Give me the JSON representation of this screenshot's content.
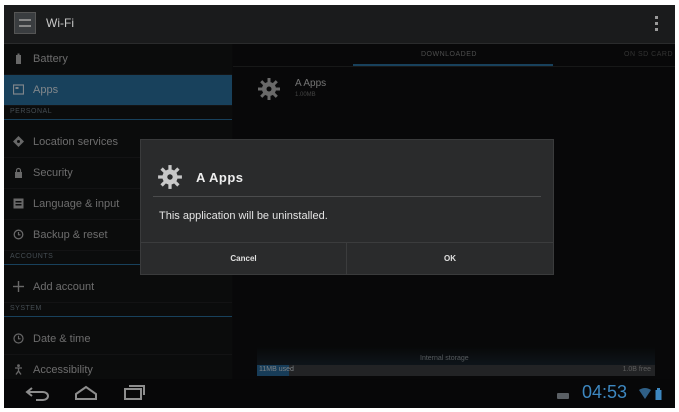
{
  "action_bar": {
    "title": "Wi-Fi"
  },
  "sidebar": {
    "items": [
      {
        "type": "row",
        "label": "Battery",
        "icon": "battery-icon"
      },
      {
        "type": "row",
        "label": "Apps",
        "icon": "apps-icon",
        "selected": true
      },
      {
        "type": "header",
        "label": "PERSONAL"
      },
      {
        "type": "row",
        "label": "Location services",
        "icon": "location-icon"
      },
      {
        "type": "row",
        "label": "Security",
        "icon": "lock-icon"
      },
      {
        "type": "row",
        "label": "Language & input",
        "icon": "keyboard-icon"
      },
      {
        "type": "row",
        "label": "Backup & reset",
        "icon": "backup-icon"
      },
      {
        "type": "header",
        "label": "ACCOUNTS"
      },
      {
        "type": "row",
        "label": "Add account",
        "icon": "plus-icon"
      },
      {
        "type": "header",
        "label": "SYSTEM"
      },
      {
        "type": "row",
        "label": "Date & time",
        "icon": "clock-icon"
      },
      {
        "type": "row",
        "label": "Accessibility",
        "icon": "accessibility-icon"
      }
    ]
  },
  "apps_pane": {
    "tabs": {
      "downloaded": "DOWNLOADED",
      "on_sd_card": "ON SD CARD"
    },
    "app": {
      "name": "A Apps",
      "size": "1.00MB"
    },
    "storage": {
      "title": "Internal storage",
      "used_label": "11MB used",
      "free_label": "1.0B free",
      "used_fraction": 0.08
    }
  },
  "dialog": {
    "title": "A Apps",
    "message": "This application will be uninstalled.",
    "cancel_label": "Cancel",
    "ok_label": "OK"
  },
  "system_bar": {
    "time": "04:53"
  },
  "colors": {
    "accent": "#2d77a8",
    "clock": "#3d87c0",
    "background": "#111213",
    "dialog": "#2a2b2c"
  }
}
